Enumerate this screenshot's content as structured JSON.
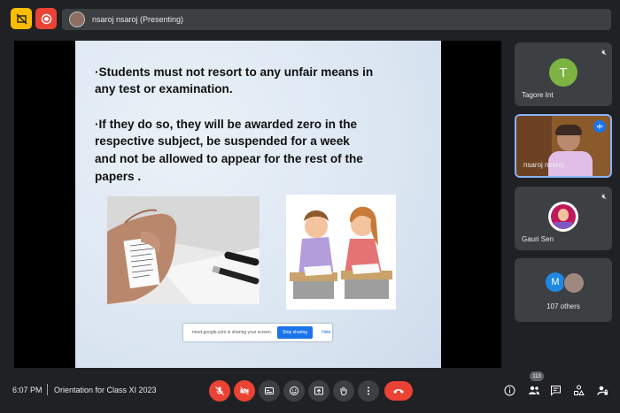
{
  "topbar": {
    "presenter_label": "nsaroj nsaroj (Presenting)"
  },
  "slide": {
    "bullet1_line1": "·Students must not resort to any unfair means in",
    "bullet1_line2": "any test or examination.",
    "bullet2_line1": "·If they do so, they will be awarded zero in the",
    "bullet2_line2": "respective subject,  be suspended for a week",
    "bullet2_line3": "and not be allowed to appear for  the rest of the",
    "bullet2_line4": "papers ."
  },
  "share_banner": {
    "message": "meet.google.com is sharing your screen.",
    "stop_label": "Stop sharing",
    "hide_label": "Hide"
  },
  "participants": {
    "tile1": {
      "initial": "T",
      "name": "Tagore Int",
      "color": "#7cb342"
    },
    "tile2": {
      "name": "nsaroj nsaroj"
    },
    "tile3": {
      "name": "Gauri Sen"
    },
    "tile4": {
      "initial": "M",
      "others": "107 others",
      "color": "#1e88e5"
    }
  },
  "bottombar": {
    "time": "6:07 PM",
    "meeting_title": "Orientation for Class XI 2023",
    "people_count": "113"
  },
  "colors": {
    "background": "#202124",
    "surface": "#3c4043",
    "danger": "#ea4335",
    "accent": "#1a73e8"
  }
}
